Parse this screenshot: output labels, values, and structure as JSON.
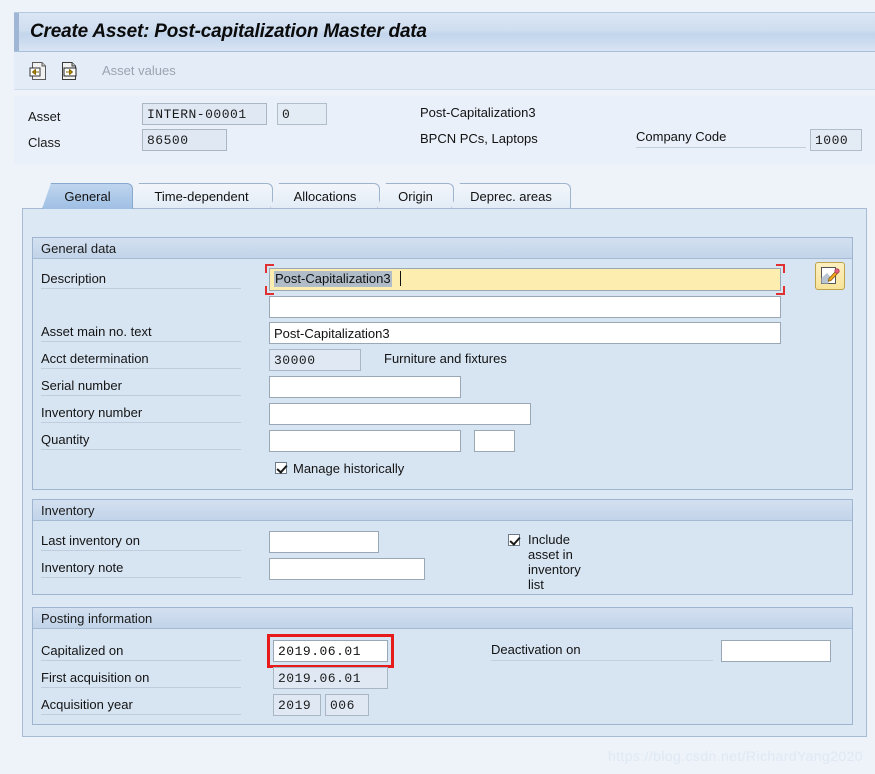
{
  "window": {
    "title": "Create Asset: Post-capitalization Master data"
  },
  "toolbar": {
    "icons": [
      {
        "name": "asset-values-back-icon",
        "glyph": "←"
      },
      {
        "name": "asset-values-forward-icon",
        "glyph": "→"
      }
    ],
    "asset_values_label": "Asset values"
  },
  "header": {
    "asset_label": "Asset",
    "asset_number": "INTERN-00001",
    "asset_subnumber": "0",
    "asset_description": "Post-Capitalization3",
    "class_label": "Class",
    "class_value": "86500",
    "class_description": "BPCN PCs, Laptops",
    "company_code_label": "Company Code",
    "company_code_value": "1000"
  },
  "tabs": [
    {
      "label": "General",
      "active": true
    },
    {
      "label": "Time-dependent",
      "active": false
    },
    {
      "label": "Allocations",
      "active": false
    },
    {
      "label": "Origin",
      "active": false
    },
    {
      "label": "Deprec. areas",
      "active": false
    }
  ],
  "general_data": {
    "title": "General data",
    "description_label": "Description",
    "description_value": "Post-Capitalization3",
    "description_line2_value": "",
    "asset_main_no_text_label": "Asset main no. text",
    "asset_main_no_text_value": "Post-Capitalization3",
    "acct_determination_label": "Acct determination",
    "acct_determination_value": "30000",
    "acct_determination_text": "Furniture and fixtures",
    "serial_number_label": "Serial number",
    "serial_number_value": "",
    "inventory_number_label": "Inventory number",
    "inventory_number_value": "",
    "quantity_label": "Quantity",
    "quantity_value": "",
    "quantity_unit_value": "",
    "manage_historically_label": "Manage historically",
    "manage_historically_checked": true,
    "edit_button_icon": "pencil-edit-icon"
  },
  "inventory": {
    "title": "Inventory",
    "last_inventory_on_label": "Last inventory on",
    "last_inventory_on_value": "",
    "inventory_note_label": "Inventory note",
    "inventory_note_value": "",
    "include_asset_label": "Include asset in inventory list",
    "include_asset_checked": true
  },
  "posting_information": {
    "title": "Posting information",
    "capitalized_on_label": "Capitalized on",
    "capitalized_on_value": "2019.06.01",
    "capitalized_on_highlighted": true,
    "first_acquisition_on_label": "First acquisition on",
    "first_acquisition_on_value": "2019.06.01",
    "acquisition_year_label": "Acquisition year",
    "acquisition_year_value": "2019",
    "acquisition_period_value": "006",
    "deactivation_on_label": "Deactivation on",
    "deactivation_on_value": ""
  },
  "watermark": "https://blog.csdn.net/RichardYang2020",
  "colors": {
    "titlebar": "#cfdef0",
    "panel": "#dde8f5",
    "group": "#d7e4f2",
    "focus_field": "#fdeeb0",
    "focus_corner": "#e03030",
    "highlight_box": "#e81b1b",
    "readonly_field": "#dfe8f3"
  }
}
